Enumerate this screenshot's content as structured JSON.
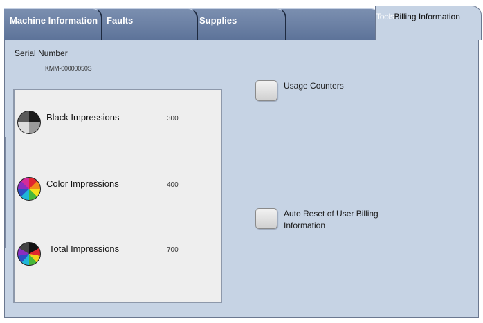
{
  "tabs": {
    "machine_information": "Machine Information",
    "faults": "Faults",
    "supplies": "Supplies",
    "tools": "Tools",
    "billing_information": "Billing Information"
  },
  "serial": {
    "label": "Serial Number",
    "value": "KMM-00000050S"
  },
  "impressions": [
    {
      "label": "Black Impressions",
      "value": "300",
      "icon": "black-impressions-icon"
    },
    {
      "label": "Color Impressions",
      "value": "400",
      "icon": "color-impressions-icon"
    },
    {
      "label": "Total Impressions",
      "value": "700",
      "icon": "total-impressions-icon"
    }
  ],
  "options": {
    "usage_counters": "Usage Counters",
    "auto_reset_line1": "Auto Reset of User Billing",
    "auto_reset_line2": "Information"
  },
  "colors": {
    "tab_inactive": "#6b80a6",
    "panel_background": "#c6d3e4",
    "impressions_background": "#eeeeee"
  }
}
